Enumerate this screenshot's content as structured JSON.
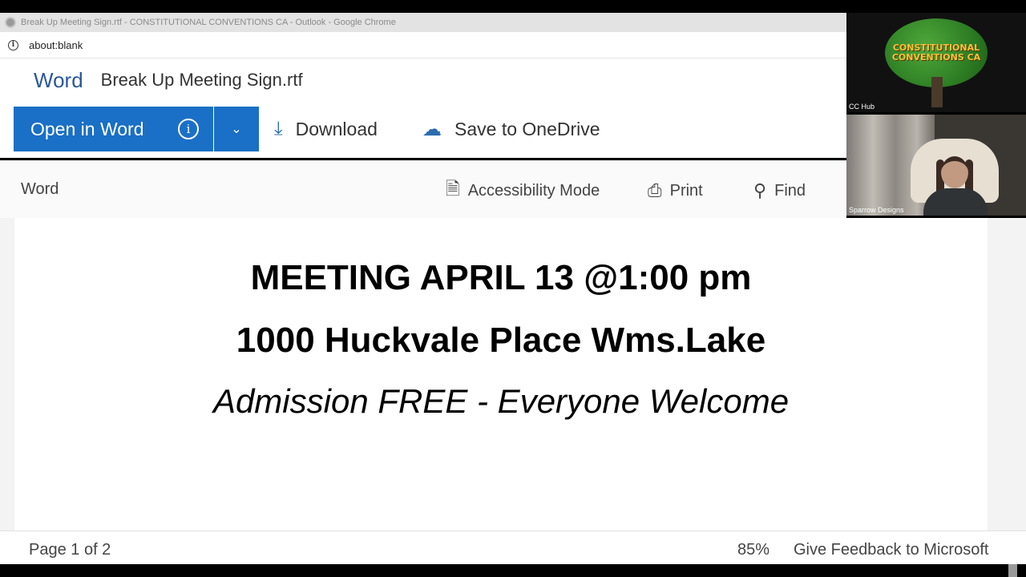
{
  "browser": {
    "window_title": "Break Up Meeting Sign.rtf - CONSTITUTIONAL CONVENTIONS CA - Outlook - Google Chrome",
    "url": "about:blank"
  },
  "word_header": {
    "app_name": "Word",
    "document_name": "Break Up Meeting Sign.rtf"
  },
  "toolbar": {
    "open_in_word": "Open in Word",
    "download": "Download",
    "save_to_onedrive": "Save to OneDrive"
  },
  "command_bar": {
    "label": "Word",
    "accessibility_mode": "Accessibility Mode",
    "print": "Print",
    "find": "Find"
  },
  "document": {
    "line1": "MEETING APRIL 13 @1:00 pm",
    "line2": "1000 Huckvale Place Wms.Lake",
    "line3": "Admission FREE - Everyone Welcome"
  },
  "status_bar": {
    "page": "Page 1 of 2",
    "zoom": "85%",
    "feedback": "Give Feedback to Microsoft"
  },
  "video_panel": {
    "tile1_name": "CC Hub",
    "tile1_logo_text": "CONSTITUTIONAL CONVENTIONS CA",
    "tile2_name": "Sparrow Designs"
  },
  "colors": {
    "word_blue": "#2b579a",
    "button_blue": "#1a6fc6"
  }
}
